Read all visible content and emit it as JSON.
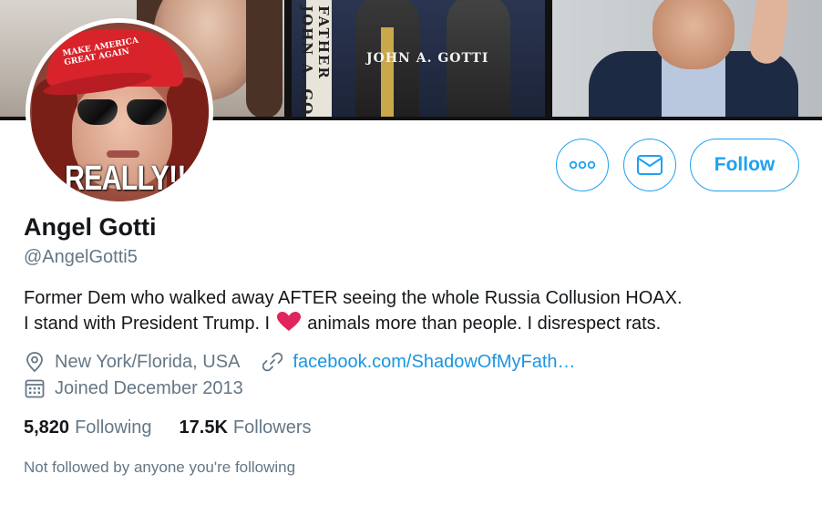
{
  "banner": {
    "spine_text": "FATHER JOHN A. GO",
    "book_title": "JOHN A. GOTTI"
  },
  "avatar": {
    "cap_text_line1": "MAKE AMERICA",
    "cap_text_line2": "GREAT AGAIN",
    "overlay_text": "REALLY!!"
  },
  "actions": {
    "follow_label": "Follow"
  },
  "profile": {
    "name": "Angel Gotti",
    "handle": "@AngelGotti5",
    "bio_line1": "Former Dem who walked away AFTER seeing the whole Russia Collusion HOAX.",
    "bio_line2_before": "I stand with President Trump. I",
    "bio_line2_after": "animals more than people. I disrespect rats.",
    "location": "New York/Florida, USA",
    "website": "facebook.com/ShadowOfMyFath…",
    "joined": "Joined December 2013"
  },
  "stats": {
    "following_count": "5,820",
    "following_label": "Following",
    "followers_count": "17.5K",
    "followers_label": "Followers"
  },
  "footer_note": "Not followed by anyone you're following",
  "colors": {
    "accent": "#1da1f2",
    "link": "#1b95e0",
    "muted": "#657786",
    "text": "#14171a",
    "heart": "#e0245e"
  }
}
